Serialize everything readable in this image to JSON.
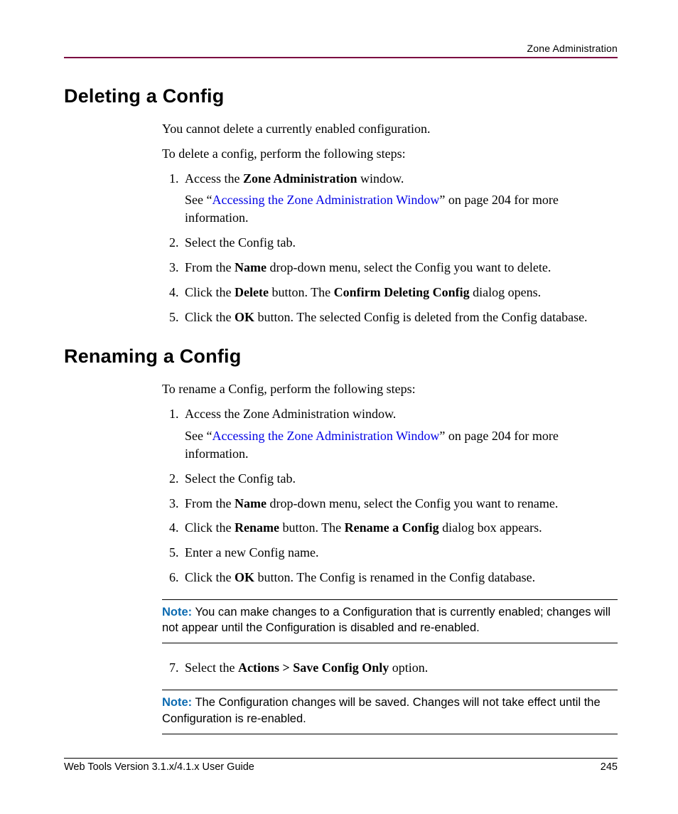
{
  "header": {
    "section_label": "Zone Administration"
  },
  "sections": {
    "del": {
      "title": "Deleting a Config",
      "intro1": "You cannot delete a currently enabled configuration.",
      "intro2": "To delete a config, perform the following steps:",
      "step1_a": "Access the ",
      "step1_b": "Zone Administration",
      "step1_c": " window.",
      "see_a": "See “",
      "link": "Accessing the Zone Administration Window",
      "see_b": "” on page 204 for more information.",
      "step2": "Select the Config tab.",
      "step3_a": "From the ",
      "step3_b": "Name",
      "step3_c": " drop-down menu, select the Config you want to delete.",
      "step4_a": "Click the ",
      "step4_b": "Delete",
      "step4_c": " button. The ",
      "step4_d": "Confirm Deleting Config",
      "step4_e": " dialog opens.",
      "step5_a": "Click the ",
      "step5_b": "OK",
      "step5_c": " button. The selected Config is deleted from the Config database."
    },
    "ren": {
      "title": "Renaming a Config",
      "intro": "To rename a Config, perform the following steps:",
      "step1": "Access the Zone Administration window.",
      "see_a": "See “",
      "link": "Accessing the Zone Administration Window",
      "see_b": "” on page 204 for more information.",
      "step2": "Select the Config tab.",
      "step3_a": "From the ",
      "step3_b": "Name",
      "step3_c": " drop-down menu, select the Config you want to rename.",
      "step4_a": "Click the ",
      "step4_b": "Rename",
      "step4_c": " button. The ",
      "step4_d": "Rename a Config",
      "step4_e": " dialog box appears.",
      "step5": "Enter a new Config name.",
      "step6_a": "Click the ",
      "step6_b": "OK",
      "step6_c": " button. The Config is renamed in the Config database.",
      "note1_label": "Note:",
      "note1_body": " You can make changes to a Configuration that is currently enabled; changes will not appear until the Configuration is disabled and re-enabled.",
      "step7_a": "Select the ",
      "step7_b": "Actions > Save Config Only",
      "step7_c": " option.",
      "note2_label": "Note:",
      "note2_body": " The Configuration changes will be saved. Changes will not take effect until the Configuration is re-enabled."
    }
  },
  "footer": {
    "guide": "Web Tools Version 3.1.x/4.1.x User Guide",
    "page": "245"
  }
}
